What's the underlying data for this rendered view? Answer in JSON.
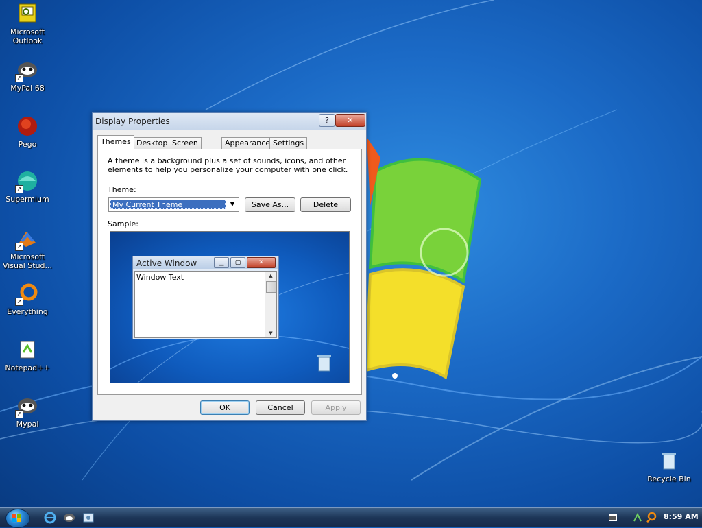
{
  "desktop": {
    "icons": [
      {
        "label": "Microsoft\nOutlook",
        "icon": "outlook-icon"
      },
      {
        "label": "MyPal 68",
        "icon": "mypal-icon"
      },
      {
        "label": "Pego",
        "icon": "pego-icon"
      },
      {
        "label": "Supermium",
        "icon": "supermium-icon"
      },
      {
        "label": "Microsoft\nVisual Stud...",
        "icon": "visual-studio-icon"
      },
      {
        "label": "Everything",
        "icon": "everything-icon"
      },
      {
        "label": "Notepad++",
        "icon": "notepadpp-icon"
      },
      {
        "label": "Mypal",
        "icon": "mypal-icon"
      },
      {
        "label": "Recycle Bin",
        "icon": "recycle-bin-icon"
      }
    ]
  },
  "dialog": {
    "title": "Display Properties",
    "help_glyph": "?",
    "close_glyph": "✕",
    "tabs": [
      "Themes",
      "Desktop",
      "Screen Saver",
      "Appearance",
      "Settings"
    ],
    "active_tab": "Themes",
    "description": "A theme is a background plus a set of sounds, icons, and other elements to help you personalize your computer with one click.",
    "theme_label": "Theme:",
    "theme_value": "My Current Theme",
    "save_as_label": "Save As...",
    "delete_label": "Delete",
    "sample_label": "Sample:",
    "sample": {
      "window_title": "Active Window",
      "window_text": "Window Text"
    },
    "ok_label": "OK",
    "cancel_label": "Cancel",
    "apply_label": "Apply"
  },
  "taskbar": {
    "clock": "8:59 AM",
    "quicklaunch": [
      "internet-explorer-icon",
      "mypal-icon",
      "explorer-icon"
    ],
    "tray": [
      "show-desktop-icon",
      "network-icon",
      "search-icon"
    ]
  },
  "colors": {
    "selection": "#3c6fbf",
    "desktop_bg": "#1b6ac6"
  }
}
